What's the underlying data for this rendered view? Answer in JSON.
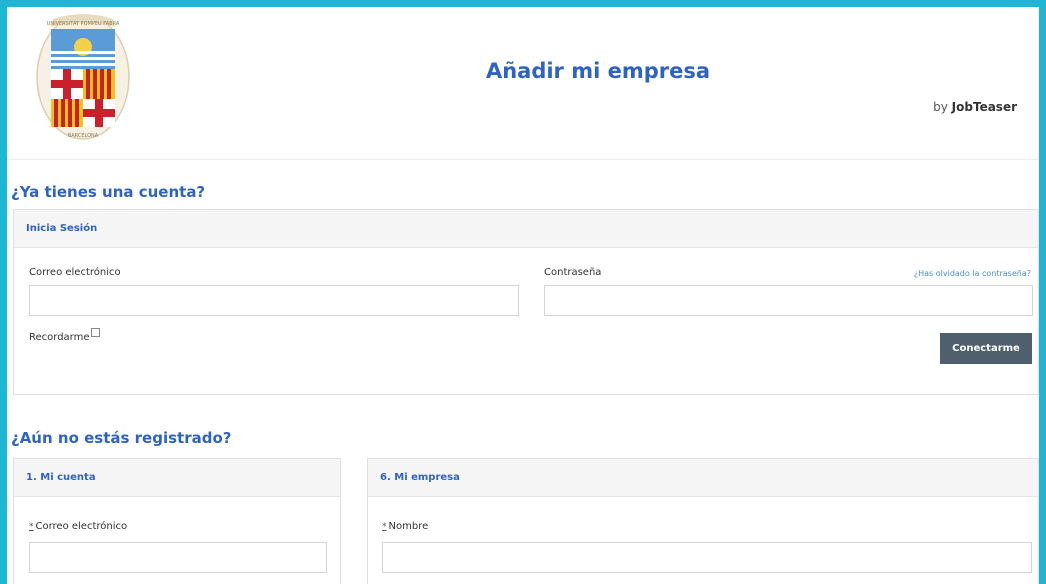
{
  "header": {
    "title": "Añadir mi empresa",
    "byline_prefix": "by",
    "byline_brand": "JobTeaser",
    "logo_top_text": "UNIVERSITAT POMPEU FABRA",
    "logo_bottom_text": "BARCELONA"
  },
  "login_section": {
    "heading": "¿Ya tienes una cuenta?",
    "panel_title": "Inicia Sesión",
    "email_label": "Correo electrónico",
    "email_value": "",
    "password_label": "Contraseña",
    "password_value": "",
    "forgot_link": "¿Has olvidado la contraseña?",
    "remember_label": "Recordarme",
    "remember_checked": false,
    "submit_label": "Conectarme"
  },
  "register_section": {
    "heading": "¿Aún no estás registrado?",
    "account_panel": {
      "title": "1. Mi cuenta",
      "required_mark": "*",
      "email_label": "Correo electrónico",
      "email_value": ""
    },
    "company_panel": {
      "title": "6. Mi empresa",
      "required_mark": "*",
      "name_label": "Nombre",
      "name_value": ""
    }
  },
  "colors": {
    "frame": "#1fb6d4",
    "accent": "#2e63c4",
    "button": "#4f5f6d",
    "link": "#4a8fd6"
  }
}
